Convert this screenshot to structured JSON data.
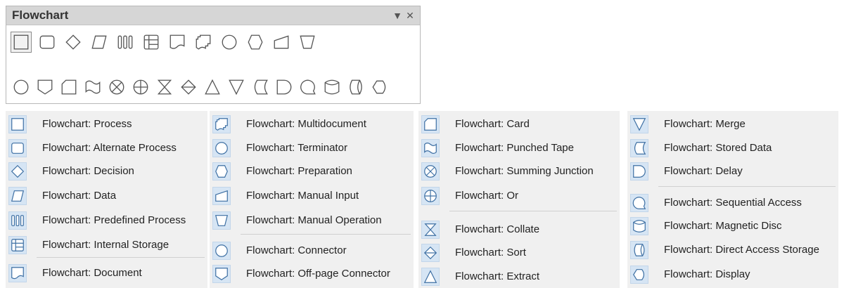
{
  "toolbar": {
    "title": "Flowchart",
    "dropdown_icon": "▼",
    "close_icon": "✕",
    "row1": [
      "process",
      "alternate-process",
      "decision",
      "data",
      "predefined-process",
      "internal-storage",
      "document",
      "multidocument",
      "terminator",
      "preparation",
      "manual-input",
      "manual-operation"
    ],
    "row2": [
      "connector",
      "off-page-connector",
      "card",
      "punched-tape",
      "summing-junction",
      "or",
      "collate",
      "sort",
      "extract",
      "merge",
      "stored-data",
      "delay",
      "sequential-access",
      "magnetic-disc",
      "direct-access-storage",
      "display"
    ]
  },
  "menu": {
    "col1": [
      {
        "icon": "process",
        "label": "Flowchart: Process"
      },
      {
        "icon": "alternate-process",
        "label": "Flowchart: Alternate Process"
      },
      {
        "icon": "decision",
        "label": "Flowchart: Decision"
      },
      {
        "icon": "data",
        "label": "Flowchart: Data"
      },
      {
        "icon": "predefined-process",
        "label": "Flowchart: Predefined Process"
      },
      {
        "icon": "internal-storage",
        "label": "Flowchart: Internal Storage"
      },
      {
        "icon": "document",
        "label": "Flowchart: Document"
      }
    ],
    "col2": [
      {
        "icon": "multidocument",
        "label": "Flowchart: Multidocument"
      },
      {
        "icon": "terminator",
        "label": "Flowchart: Terminator"
      },
      {
        "icon": "preparation",
        "label": "Flowchart: Preparation"
      },
      {
        "icon": "manual-input",
        "label": "Flowchart: Manual Input"
      },
      {
        "icon": "manual-operation",
        "label": "Flowchart: Manual Operation"
      },
      {
        "icon": "connector",
        "label": "Flowchart: Connector"
      },
      {
        "icon": "off-page-connector",
        "label": "Flowchart: Off-page Connector"
      }
    ],
    "col3": [
      {
        "icon": "card",
        "label": "Flowchart: Card"
      },
      {
        "icon": "punched-tape",
        "label": "Flowchart: Punched Tape"
      },
      {
        "icon": "summing-junction",
        "label": "Flowchart: Summing Junction"
      },
      {
        "icon": "or",
        "label": "Flowchart: Or"
      },
      {
        "icon": "collate",
        "label": "Flowchart: Collate"
      },
      {
        "icon": "sort",
        "label": "Flowchart: Sort"
      },
      {
        "icon": "extract",
        "label": "Flowchart: Extract"
      }
    ],
    "col4": [
      {
        "icon": "merge",
        "label": "Flowchart: Merge"
      },
      {
        "icon": "stored-data",
        "label": "Flowchart: Stored Data"
      },
      {
        "icon": "delay",
        "label": "Flowchart: Delay"
      },
      {
        "icon": "sequential-access",
        "label": "Flowchart: Sequential Access"
      },
      {
        "icon": "magnetic-disc",
        "label": "Flowchart: Magnetic Disc"
      },
      {
        "icon": "direct-access-storage",
        "label": "Flowchart: Direct Access Storage"
      },
      {
        "icon": "display",
        "label": "Flowchart: Display"
      }
    ]
  }
}
